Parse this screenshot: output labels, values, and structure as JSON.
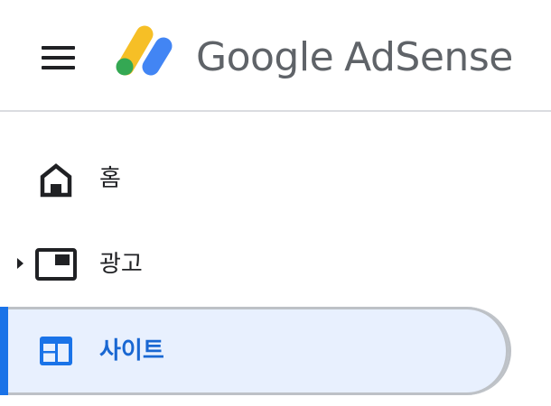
{
  "header": {
    "menu_icon": "menu-icon",
    "logo_icon": "adsense-logo-icon",
    "brand_google": "Google",
    "brand_product": "AdSense",
    "logo_colors": {
      "yellow": "#f6bf26",
      "blue": "#4285f4",
      "green": "#34a853"
    }
  },
  "nav": {
    "items": [
      {
        "label": "홈",
        "icon": "home-icon",
        "active": false
      },
      {
        "label": "광고",
        "icon": "ad-unit-icon",
        "active": false,
        "expandable": true,
        "expander_icon": "triangle-right-icon"
      },
      {
        "label": "사이트",
        "icon": "sites-icon",
        "active": true
      }
    ]
  },
  "colors": {
    "active_background": "#e8f0fe",
    "active_text": "#1967d2",
    "active_bar": "#1a73e8",
    "text": "#202124",
    "divider": "#dadce0"
  }
}
